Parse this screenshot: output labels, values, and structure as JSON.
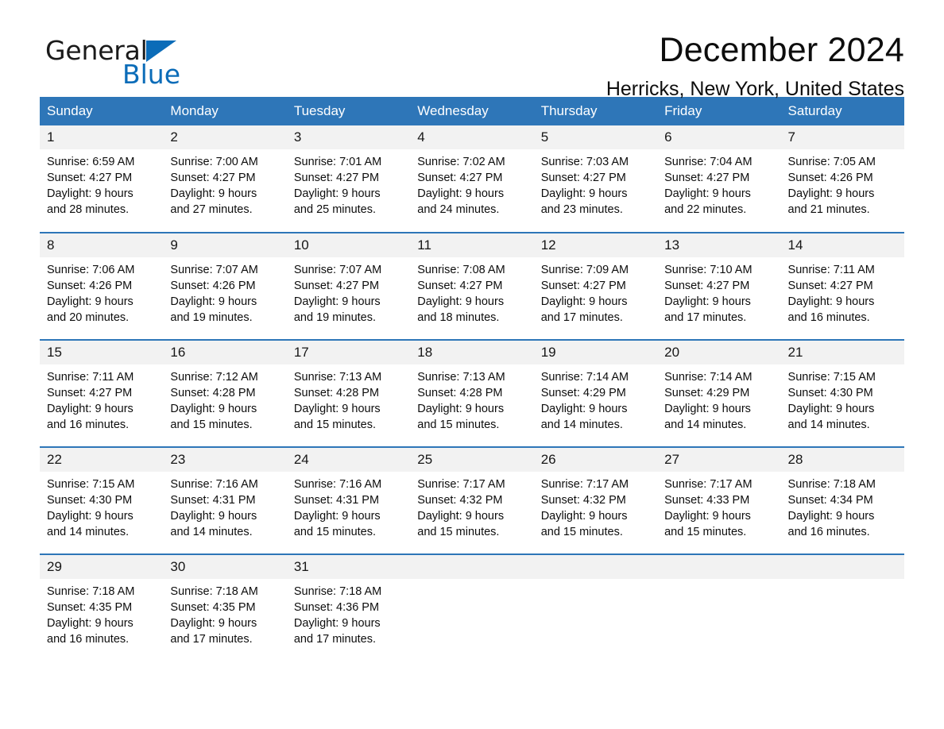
{
  "brand": {
    "name_part1": "General",
    "name_part2": "Blue",
    "accent_color": "#0b6cb8",
    "logo_icon": "triangle-mark"
  },
  "header": {
    "title": "December 2024",
    "subtitle": "Herricks, New York, United States",
    "header_bg_color": "#2e76b8",
    "daynum_bg_color": "#f2f2f2"
  },
  "calendar": {
    "weekday_headers": [
      "Sunday",
      "Monday",
      "Tuesday",
      "Wednesday",
      "Thursday",
      "Friday",
      "Saturday"
    ],
    "weeks": [
      [
        {
          "day": "1",
          "sunrise": "Sunrise: 6:59 AM",
          "sunset": "Sunset: 4:27 PM",
          "daylight_line1": "Daylight: 9 hours",
          "daylight_line2": "and 28 minutes."
        },
        {
          "day": "2",
          "sunrise": "Sunrise: 7:00 AM",
          "sunset": "Sunset: 4:27 PM",
          "daylight_line1": "Daylight: 9 hours",
          "daylight_line2": "and 27 minutes."
        },
        {
          "day": "3",
          "sunrise": "Sunrise: 7:01 AM",
          "sunset": "Sunset: 4:27 PM",
          "daylight_line1": "Daylight: 9 hours",
          "daylight_line2": "and 25 minutes."
        },
        {
          "day": "4",
          "sunrise": "Sunrise: 7:02 AM",
          "sunset": "Sunset: 4:27 PM",
          "daylight_line1": "Daylight: 9 hours",
          "daylight_line2": "and 24 minutes."
        },
        {
          "day": "5",
          "sunrise": "Sunrise: 7:03 AM",
          "sunset": "Sunset: 4:27 PM",
          "daylight_line1": "Daylight: 9 hours",
          "daylight_line2": "and 23 minutes."
        },
        {
          "day": "6",
          "sunrise": "Sunrise: 7:04 AM",
          "sunset": "Sunset: 4:27 PM",
          "daylight_line1": "Daylight: 9 hours",
          "daylight_line2": "and 22 minutes."
        },
        {
          "day": "7",
          "sunrise": "Sunrise: 7:05 AM",
          "sunset": "Sunset: 4:26 PM",
          "daylight_line1": "Daylight: 9 hours",
          "daylight_line2": "and 21 minutes."
        }
      ],
      [
        {
          "day": "8",
          "sunrise": "Sunrise: 7:06 AM",
          "sunset": "Sunset: 4:26 PM",
          "daylight_line1": "Daylight: 9 hours",
          "daylight_line2": "and 20 minutes."
        },
        {
          "day": "9",
          "sunrise": "Sunrise: 7:07 AM",
          "sunset": "Sunset: 4:26 PM",
          "daylight_line1": "Daylight: 9 hours",
          "daylight_line2": "and 19 minutes."
        },
        {
          "day": "10",
          "sunrise": "Sunrise: 7:07 AM",
          "sunset": "Sunset: 4:27 PM",
          "daylight_line1": "Daylight: 9 hours",
          "daylight_line2": "and 19 minutes."
        },
        {
          "day": "11",
          "sunrise": "Sunrise: 7:08 AM",
          "sunset": "Sunset: 4:27 PM",
          "daylight_line1": "Daylight: 9 hours",
          "daylight_line2": "and 18 minutes."
        },
        {
          "day": "12",
          "sunrise": "Sunrise: 7:09 AM",
          "sunset": "Sunset: 4:27 PM",
          "daylight_line1": "Daylight: 9 hours",
          "daylight_line2": "and 17 minutes."
        },
        {
          "day": "13",
          "sunrise": "Sunrise: 7:10 AM",
          "sunset": "Sunset: 4:27 PM",
          "daylight_line1": "Daylight: 9 hours",
          "daylight_line2": "and 17 minutes."
        },
        {
          "day": "14",
          "sunrise": "Sunrise: 7:11 AM",
          "sunset": "Sunset: 4:27 PM",
          "daylight_line1": "Daylight: 9 hours",
          "daylight_line2": "and 16 minutes."
        }
      ],
      [
        {
          "day": "15",
          "sunrise": "Sunrise: 7:11 AM",
          "sunset": "Sunset: 4:27 PM",
          "daylight_line1": "Daylight: 9 hours",
          "daylight_line2": "and 16 minutes."
        },
        {
          "day": "16",
          "sunrise": "Sunrise: 7:12 AM",
          "sunset": "Sunset: 4:28 PM",
          "daylight_line1": "Daylight: 9 hours",
          "daylight_line2": "and 15 minutes."
        },
        {
          "day": "17",
          "sunrise": "Sunrise: 7:13 AM",
          "sunset": "Sunset: 4:28 PM",
          "daylight_line1": "Daylight: 9 hours",
          "daylight_line2": "and 15 minutes."
        },
        {
          "day": "18",
          "sunrise": "Sunrise: 7:13 AM",
          "sunset": "Sunset: 4:28 PM",
          "daylight_line1": "Daylight: 9 hours",
          "daylight_line2": "and 15 minutes."
        },
        {
          "day": "19",
          "sunrise": "Sunrise: 7:14 AM",
          "sunset": "Sunset: 4:29 PM",
          "daylight_line1": "Daylight: 9 hours",
          "daylight_line2": "and 14 minutes."
        },
        {
          "day": "20",
          "sunrise": "Sunrise: 7:14 AM",
          "sunset": "Sunset: 4:29 PM",
          "daylight_line1": "Daylight: 9 hours",
          "daylight_line2": "and 14 minutes."
        },
        {
          "day": "21",
          "sunrise": "Sunrise: 7:15 AM",
          "sunset": "Sunset: 4:30 PM",
          "daylight_line1": "Daylight: 9 hours",
          "daylight_line2": "and 14 minutes."
        }
      ],
      [
        {
          "day": "22",
          "sunrise": "Sunrise: 7:15 AM",
          "sunset": "Sunset: 4:30 PM",
          "daylight_line1": "Daylight: 9 hours",
          "daylight_line2": "and 14 minutes."
        },
        {
          "day": "23",
          "sunrise": "Sunrise: 7:16 AM",
          "sunset": "Sunset: 4:31 PM",
          "daylight_line1": "Daylight: 9 hours",
          "daylight_line2": "and 14 minutes."
        },
        {
          "day": "24",
          "sunrise": "Sunrise: 7:16 AM",
          "sunset": "Sunset: 4:31 PM",
          "daylight_line1": "Daylight: 9 hours",
          "daylight_line2": "and 15 minutes."
        },
        {
          "day": "25",
          "sunrise": "Sunrise: 7:17 AM",
          "sunset": "Sunset: 4:32 PM",
          "daylight_line1": "Daylight: 9 hours",
          "daylight_line2": "and 15 minutes."
        },
        {
          "day": "26",
          "sunrise": "Sunrise: 7:17 AM",
          "sunset": "Sunset: 4:32 PM",
          "daylight_line1": "Daylight: 9 hours",
          "daylight_line2": "and 15 minutes."
        },
        {
          "day": "27",
          "sunrise": "Sunrise: 7:17 AM",
          "sunset": "Sunset: 4:33 PM",
          "daylight_line1": "Daylight: 9 hours",
          "daylight_line2": "and 15 minutes."
        },
        {
          "day": "28",
          "sunrise": "Sunrise: 7:18 AM",
          "sunset": "Sunset: 4:34 PM",
          "daylight_line1": "Daylight: 9 hours",
          "daylight_line2": "and 16 minutes."
        }
      ],
      [
        {
          "day": "29",
          "sunrise": "Sunrise: 7:18 AM",
          "sunset": "Sunset: 4:35 PM",
          "daylight_line1": "Daylight: 9 hours",
          "daylight_line2": "and 16 minutes."
        },
        {
          "day": "30",
          "sunrise": "Sunrise: 7:18 AM",
          "sunset": "Sunset: 4:35 PM",
          "daylight_line1": "Daylight: 9 hours",
          "daylight_line2": "and 17 minutes."
        },
        {
          "day": "31",
          "sunrise": "Sunrise: 7:18 AM",
          "sunset": "Sunset: 4:36 PM",
          "daylight_line1": "Daylight: 9 hours",
          "daylight_line2": "and 17 minutes."
        },
        {
          "day": "",
          "sunrise": "",
          "sunset": "",
          "daylight_line1": "",
          "daylight_line2": ""
        },
        {
          "day": "",
          "sunrise": "",
          "sunset": "",
          "daylight_line1": "",
          "daylight_line2": ""
        },
        {
          "day": "",
          "sunrise": "",
          "sunset": "",
          "daylight_line1": "",
          "daylight_line2": ""
        },
        {
          "day": "",
          "sunrise": "",
          "sunset": "",
          "daylight_line1": "",
          "daylight_line2": ""
        }
      ]
    ]
  }
}
